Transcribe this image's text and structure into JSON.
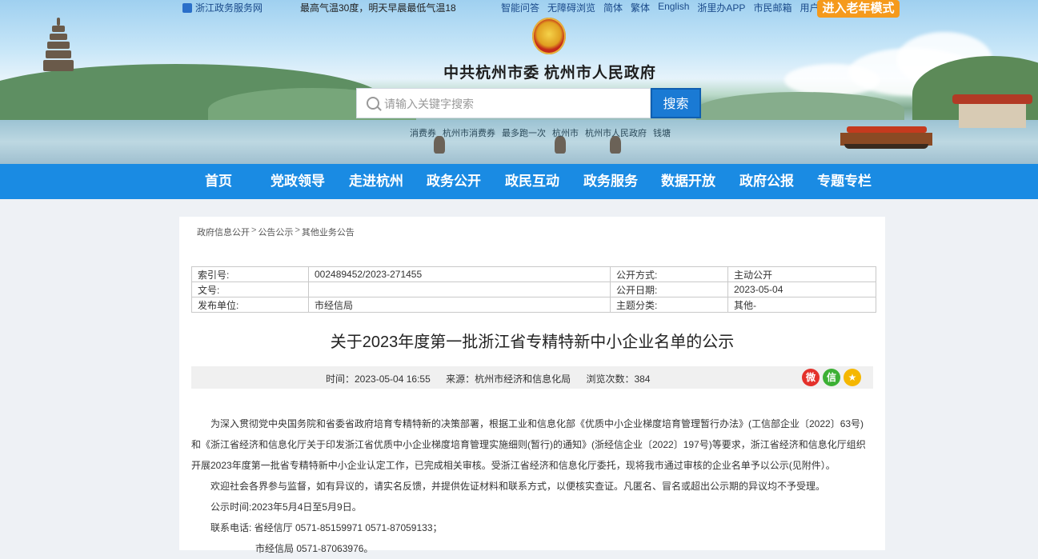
{
  "topbar": {
    "gov_service": "浙江政务服务网",
    "weather": "最高气温30度，明天早晨最低气温18",
    "links": [
      "智能问答",
      "无障碍浏览",
      "简体",
      "繁体",
      "English",
      "浙里办APP",
      "市民邮箱",
      "用户中心"
    ],
    "elder_mode": "进入老年模式"
  },
  "header": {
    "site_title": "中共杭州市委  杭州市人民政府",
    "search_placeholder": "请输入关键字搜索",
    "search_button": "搜索",
    "hot_words": [
      "消费券",
      "杭州市消费券",
      "最多跑一次",
      "杭州市",
      "杭州市人民政府",
      "钱塘"
    ]
  },
  "nav": [
    "首页",
    "党政领导",
    "走进杭州",
    "政务公开",
    "政民互动",
    "政务服务",
    "数据开放",
    "政府公报",
    "专题专栏"
  ],
  "breadcrumb": [
    "政府信息公开",
    "公告公示",
    "其他业务公告"
  ],
  "meta": {
    "index_label": "索引号:",
    "index_value": "002489452/2023-271455",
    "method_label": "公开方式:",
    "method_value": "主动公开",
    "docno_label": "文号:",
    "docno_value": "",
    "date_label": "公开日期:",
    "date_value": "2023-05-04",
    "unit_label": "发布单位:",
    "unit_value": "市经信局",
    "topic_label": "主题分类:",
    "topic_value": "其他-"
  },
  "article": {
    "title": "关于2023年度第一批浙江省专精特新中小企业名单的公示",
    "time": "时间：2023-05-04 16:55",
    "source": "来源：杭州市经济和信息化局",
    "views": "浏览次数：384",
    "share_icons": [
      "weibo-icon",
      "wechat-icon",
      "favorite-icon"
    ],
    "paragraph1": "为深入贯彻党中央国务院和省委省政府培育专精特新的决策部署，根据工业和信息化部《优质中小企业梯度培育管理暂行办法》(工信部企业〔2022〕63号)和《浙江省经济和信息化厅关于印发浙江省优质中小企业梯度培育管理实施细则(暂行)的通知》(浙经信企业〔2022〕197号)等要求，浙江省经济和信息化厅组织开展2023年度第一批省专精特新中小企业认定工作，已完成相关审核。受浙江省经济和信息化厅委托，现将我市通过审核的企业名单予以公示(见附件）。",
    "paragraph2": "欢迎社会各界参与监督，如有异议的，请实名反馈，并提供佐证材料和联系方式，以便核实查证。凡匿名、冒名或超出公示期的异议均不予受理。",
    "paragraph3": "公示时间:2023年5月4日至5月9日。",
    "paragraph4": "联系电话: 省经信厅 0571-85159971 0571-87059133；",
    "paragraph5": "市经信局 0571-87063976。"
  },
  "colors": {
    "nav_bg": "#1a8be3",
    "elder_btn": "#f59a1c",
    "search_btn": "#1a7ad4"
  }
}
